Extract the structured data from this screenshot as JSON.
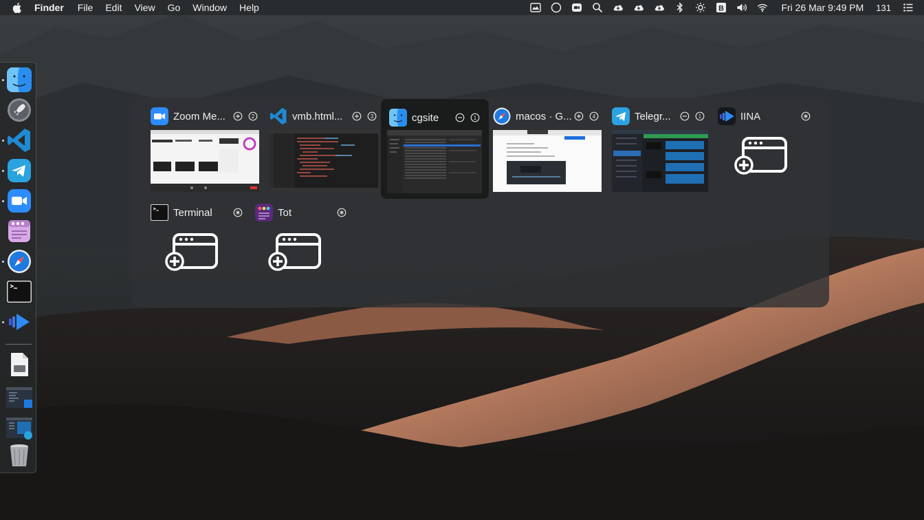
{
  "menubar": {
    "app_name": "Finder",
    "menus": [
      "File",
      "Edit",
      "View",
      "Go",
      "Window",
      "Help"
    ],
    "status_icons": [
      "image-capture-icon",
      "circle-icon",
      "camera-icon",
      "search-icon",
      "cloud-upload-icon",
      "cloud-upload-icon",
      "cloud-upload-icon",
      "bluetooth-icon",
      "brightness-icon",
      "b-icon",
      "volume-icon",
      "wifi-icon"
    ],
    "clock": "Fri 26 Mar  9:49 PM",
    "count": "131"
  },
  "dock": {
    "items": [
      "finder-icon",
      "launchpad-icon",
      "vscode-icon",
      "telegram-icon",
      "zoom-icon",
      "tot-icon",
      "safari-icon",
      "terminal-icon",
      "iina-icon"
    ],
    "running": [
      "finder",
      "vscode",
      "telegram",
      "zoom",
      "safari",
      "iina"
    ],
    "stack_items": [
      "document-icon",
      "window-preview-icon",
      "window-preview-icon",
      "trash-icon"
    ]
  },
  "switcher": {
    "windows": [
      {
        "app": "zoom",
        "title": "Zoom Me...",
        "shortcut_a": "⊕",
        "shortcut_b": "②",
        "has_thumbnail": true,
        "selected": false
      },
      {
        "app": "vscode",
        "title": "vmb.html...",
        "shortcut_a": "⊕",
        "shortcut_b": "③",
        "has_thumbnail": true,
        "selected": false
      },
      {
        "app": "finder",
        "title": "cgsite",
        "shortcut_a": "⊖",
        "shortcut_b": "①",
        "has_thumbnail": true,
        "selected": true
      },
      {
        "app": "safari",
        "title": "macos · G...",
        "shortcut_a": "⊕",
        "shortcut_b": "④",
        "has_thumbnail": true,
        "selected": false
      },
      {
        "app": "telegram",
        "title": "Telegr...",
        "shortcut_a": "⊖",
        "shortcut_b": "①",
        "has_thumbnail": true,
        "selected": false
      },
      {
        "app": "iina",
        "title": "IINA",
        "shortcut_a": "",
        "shortcut_b": "⊛",
        "has_thumbnail": false,
        "selected": false
      },
      {
        "app": "terminal",
        "title": "Terminal",
        "shortcut_a": "",
        "shortcut_b": "⊛",
        "has_thumbnail": false,
        "selected": false
      },
      {
        "app": "tot",
        "title": "Tot",
        "shortcut_a": "",
        "shortcut_b": "⊛",
        "has_thumbnail": false,
        "selected": false
      }
    ]
  },
  "colors": {
    "panel": "#303234",
    "selected": "#161718",
    "zoom_blue": "#2d8cff",
    "vscode_blue": "#1f8ad2",
    "telegram_blue": "#2aa3e0",
    "finder_blue": "#3b9cf0"
  }
}
